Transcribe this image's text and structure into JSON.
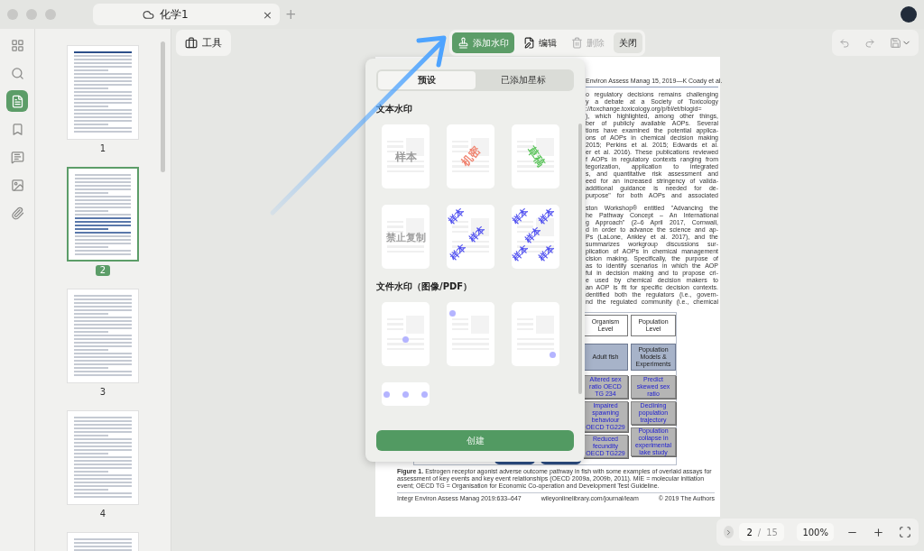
{
  "tab": {
    "title": "化学1",
    "close": "×",
    "add": "+"
  },
  "left_rail": [
    {
      "kind": "grid",
      "selected": false
    },
    {
      "kind": "search",
      "selected": false
    },
    {
      "kind": "pages",
      "selected": true
    },
    {
      "kind": "bookmark",
      "selected": false
    },
    {
      "kind": "comment",
      "selected": false
    },
    {
      "kind": "image",
      "selected": false
    },
    {
      "kind": "attachment",
      "selected": false
    }
  ],
  "thumbnails": [
    {
      "label": "1",
      "selected": false
    },
    {
      "label": "2",
      "selected": true
    },
    {
      "label": "3",
      "selected": false
    },
    {
      "label": "4",
      "selected": false
    },
    {
      "selected": false
    }
  ],
  "toolbar": {
    "tools": "工具",
    "actions": [
      {
        "kind": "add",
        "label": "添加水印",
        "selected": true,
        "disabled": false
      },
      {
        "kind": "edit",
        "label": "编辑",
        "selected": false,
        "disabled": false
      },
      {
        "kind": "delete",
        "label": "删除",
        "selected": false,
        "disabled": true
      },
      {
        "kind": "close",
        "label": "关闭",
        "selected": false,
        "disabled": false
      }
    ]
  },
  "document": {
    "header": "Environ Assess Manag 15, 2019—K Coady et al.",
    "paragraphs": [
      [
        "o regulatory decisions remains challenging",
        "y a debate at a Society of Toxicology",
        "://toxchange.toxicology.org/p/bl/et/blogid=",
        "), which highlighted, among other things,",
        "ber of publicly available AOPs. Several",
        "tions have examined the potential applica-",
        "ons of AOPs in chemical decision making",
        "2015; Perkins et al. 2015; Edwards et al.",
        "er et al. 2016). These publications reviewed",
        "f AOPs in regulatory contexts ranging from",
        "tegorization, application to integrated",
        "s, and quantitative risk assessment and",
        "eed for an increased stringency of valida-",
        "additional guidance is needed for de-",
        "purpose\" for both AOPs and associated"
      ],
      [
        "ston Workshop® entitled \"Advancing the",
        "he Pathway Concept – An International",
        "g Approach\" (2–6 April 2017, Cornwall,",
        "d in order to advance the science and ap-",
        "Ps (LaLone, Ankley et al. 2017), and the",
        "summarizes workgroup discussions sur-",
        "plication of AOPs in chemical management",
        "cision making. Specifically, the purpose of",
        "as to identify scenarios in which the AOP",
        "ful in decision making and to propose cri-",
        "e used by chemical decision makers to",
        "an AOP is fit for specific decision contexts.",
        "dentified both the regulators (i.e., govern-",
        "nd the regulated community (i.e., chemical"
      ]
    ],
    "diagram": {
      "levels": [
        "Organism Level",
        "Population Level"
      ],
      "events": [
        "Adult fish",
        "Population Models & Experiments"
      ],
      "assays": [
        [
          "Altered sex ratio OECD TG 234",
          "Impaired spawning behaviour OECD TG229",
          "Reduced fecundity OECD TG229"
        ],
        [
          "Predict skewed sex ratio",
          "Declining population trajectory",
          "Population collapse in experimental lake study"
        ]
      ]
    },
    "caption": "**Figure 1.** Estrogen receptor agonist adverse outcome pathway in fish with some examples of overlaid assays for assessment of key events and key event relationships (OECD 2009a, 2009b, 2011). MIE = molecular initiation event; OECD TG = Organisation for Economic Co-operation and Development Test Guideline.",
    "footer": [
      "Integr Environ Assess Manag 2019:633–647",
      "wileyonlinelibrary.com/journal/ieam",
      "© 2019 The Authors"
    ]
  },
  "watermark_panel": {
    "tabs": [
      {
        "label": "预设",
        "selected": true
      },
      {
        "label": "已添加星标",
        "selected": false
      }
    ],
    "text_section": "文本水印",
    "text_presets": [
      {
        "kind": "plain",
        "text": "样本",
        "color": "#9a9a9a"
      },
      {
        "kind": "diagonal-up",
        "text": "机密",
        "color": "#f0826e"
      },
      {
        "kind": "diagonal-down",
        "text": "草稿",
        "color": "#5cc45c"
      },
      {
        "kind": "plain",
        "text": "禁止复制",
        "color": "#a0a0a0"
      },
      {
        "kind": "tiled",
        "tiles": [
          "样本",
          "样本",
          "样本"
        ],
        "color": "#5050f0"
      },
      {
        "kind": "tiled-dense",
        "tiles": [
          "样本",
          "样本",
          "样本",
          "样本",
          "样本"
        ],
        "color": "#5050f0"
      }
    ],
    "file_section": "文件水印（图像/PDF）",
    "file_presets": [
      {
        "kind": "center"
      },
      {
        "kind": "top-left"
      },
      {
        "kind": "bottom-right"
      },
      {
        "kind": "top-row"
      }
    ],
    "create": "创建"
  },
  "status": {
    "page": "2",
    "separator": "/",
    "total": "15",
    "zoom": "100%"
  }
}
